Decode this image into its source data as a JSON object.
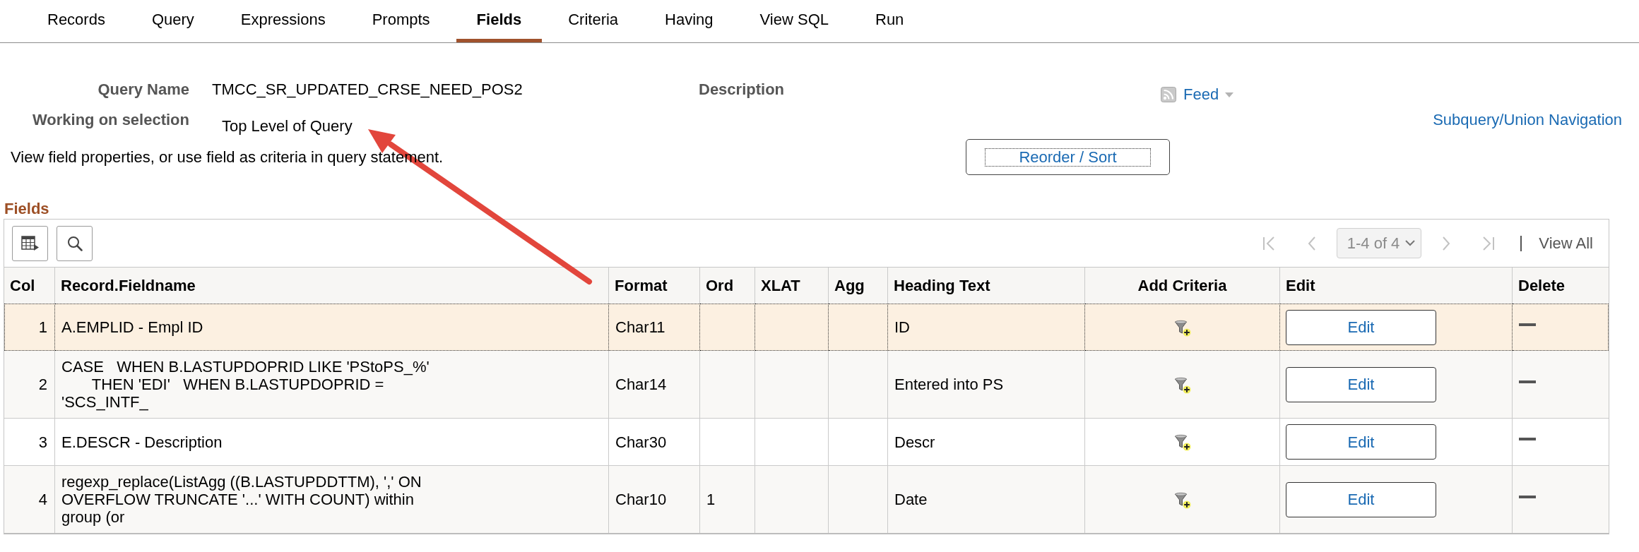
{
  "tabs": [
    {
      "label": "Records",
      "selected": false
    },
    {
      "label": "Query",
      "selected": false
    },
    {
      "label": "Expressions",
      "selected": false
    },
    {
      "label": "Prompts",
      "selected": false
    },
    {
      "label": "Fields",
      "selected": true
    },
    {
      "label": "Criteria",
      "selected": false
    },
    {
      "label": "Having",
      "selected": false
    },
    {
      "label": "View SQL",
      "selected": false
    },
    {
      "label": "Run",
      "selected": false
    }
  ],
  "query": {
    "name_label": "Query Name",
    "name": "TMCC_SR_UPDATED_CRSE_NEED_POS2",
    "description_label": "Description",
    "selection_label": "Working on selection",
    "selection": "Top Level of Query"
  },
  "feed": {
    "label": "Feed"
  },
  "subquery_link": "Subquery/Union Navigation",
  "instructions": "View field properties, or use field as criteria in query statement.",
  "reorder_button": "Reorder / Sort",
  "fields_grid": {
    "title": "Fields",
    "pagination": {
      "range": "1-4 of 4",
      "view_all": "View All",
      "navigation_disabled": true
    },
    "columns": [
      {
        "label": "Col",
        "kind": "number"
      },
      {
        "label": "Record.Fieldname",
        "kind": "text"
      },
      {
        "label": "Format",
        "kind": "text"
      },
      {
        "label": "Ord",
        "kind": "text"
      },
      {
        "label": "XLAT",
        "kind": "text"
      },
      {
        "label": "Agg",
        "kind": "text"
      },
      {
        "label": "Heading Text",
        "kind": "text"
      },
      {
        "label": "Add Criteria",
        "kind": "icon"
      },
      {
        "label": "Edit",
        "kind": "button"
      },
      {
        "label": "Delete",
        "kind": "action"
      }
    ],
    "rows": [
      {
        "col": "1",
        "fieldname": "A.EMPLID - Empl ID",
        "format": "Char11",
        "heading_text": "ID",
        "edit": "Edit",
        "selected": true
      },
      {
        "col": "2",
        "fieldname": "CASE   WHEN B.LASTUPDOPRID LIKE 'PStoPS_%'\n       THEN 'EDI'   WHEN B.LASTUPDOPRID = 'SCS_INTF_",
        "format": "Char14",
        "heading_text": "Entered into PS",
        "edit": "Edit",
        "selected": false
      },
      {
        "col": "3",
        "fieldname": "E.DESCR - Description",
        "format": "Char30",
        "heading_text": "Descr",
        "edit": "Edit",
        "selected": false
      },
      {
        "col": "4",
        "fieldname": "regexp_replace(ListAgg ((B.LASTUPDDTTM), ',' ON OVERFLOW TRUNCATE '...' WITH COUNT) within group (or",
        "format": "Char10",
        "ord": "1",
        "heading_text": "Date",
        "edit": "Edit",
        "selected": false
      }
    ]
  }
}
